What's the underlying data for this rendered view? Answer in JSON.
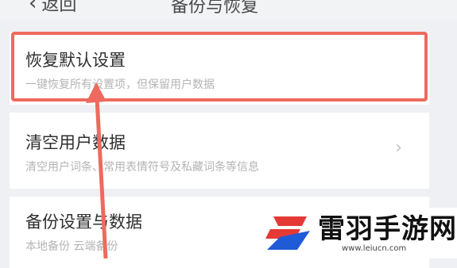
{
  "header": {
    "back_icon": "chevron-left-icon",
    "back_label": "返回",
    "title": "备份与恢复"
  },
  "settings": [
    {
      "label": "恢复默认设置",
      "description": "一键恢复所有设置项，但保留用户数据"
    },
    {
      "label": "清空用户数据",
      "description": "清空用户词条、常用表情符号及私藏词条等信息",
      "chevron_icon": "chevron-right-icon"
    },
    {
      "label": "备份设置与数据",
      "description": "本地备份  云端备份"
    }
  ],
  "annotation": {
    "color": "#ee6a5e"
  },
  "watermark": {
    "name": "雷羽手游网",
    "url": "www.leiucn.com",
    "logo_icon": "brand-logo-icon"
  }
}
